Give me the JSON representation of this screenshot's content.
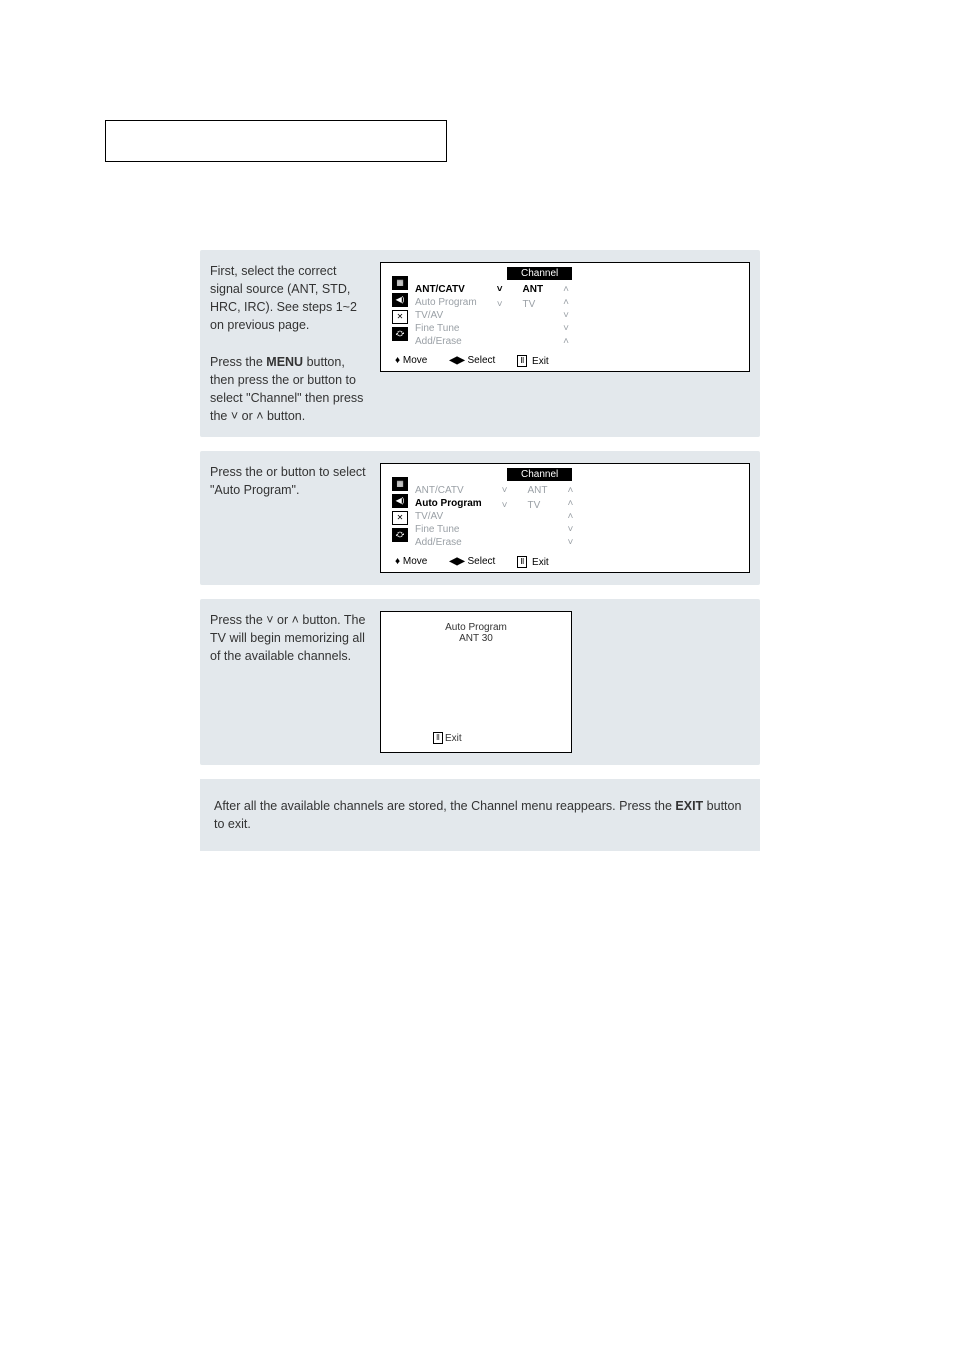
{
  "header": {},
  "steps": {
    "s1": {
      "para1": "First, select the correct signal source (ANT, STD, HRC, IRC). See steps 1~2 on previous page.",
      "para2a": "Press the ",
      "menu": "MENU",
      "para2b": " button, then press the     or     button to select \"Channel\" then press the  ˅  or  ˄  button.",
      "osd": {
        "title": "Channel",
        "rows": [
          "ANT/CATV",
          "Auto Program",
          "TV/AV",
          "Fine Tune",
          "Add/Erase"
        ],
        "vals": [
          "ANT",
          "",
          "TV",
          "",
          ""
        ],
        "arrows": [
          "˅",
          "",
          "˅",
          "",
          ""
        ],
        "right": [
          "˄",
          "˄",
          "˅",
          "˅",
          "˄"
        ],
        "footer": {
          "move": "Move",
          "select": "Select",
          "exit": "Exit"
        }
      }
    },
    "s2": {
      "text": "Press the     or     button to select \"Auto Program\".",
      "osd": {
        "title": "Channel",
        "rows": [
          "ANT/CATV",
          "Auto Program",
          "TV/AV",
          "Fine Tune",
          "Add/Erase"
        ],
        "vals": [
          "ANT",
          "",
          "TV",
          "",
          ""
        ],
        "arrows": [
          "˅",
          "",
          "˅",
          "",
          ""
        ],
        "right": [
          "˄",
          "˄",
          "˄",
          "˅",
          "˅"
        ],
        "footer": {
          "move": "Move",
          "select": "Select",
          "exit": "Exit"
        }
      }
    },
    "s3": {
      "text": "Press the  ˅  or  ˄  button. The TV will begin memorizing all of the available channels.",
      "prog": {
        "title": "Auto Program",
        "line": "ANT    30",
        "exit": "Exit"
      }
    },
    "s4": {
      "text1": "After all the available channels are stored, the Channel menu reappears. Press the ",
      "exit": "EXIT",
      "text2": " button to exit."
    }
  }
}
